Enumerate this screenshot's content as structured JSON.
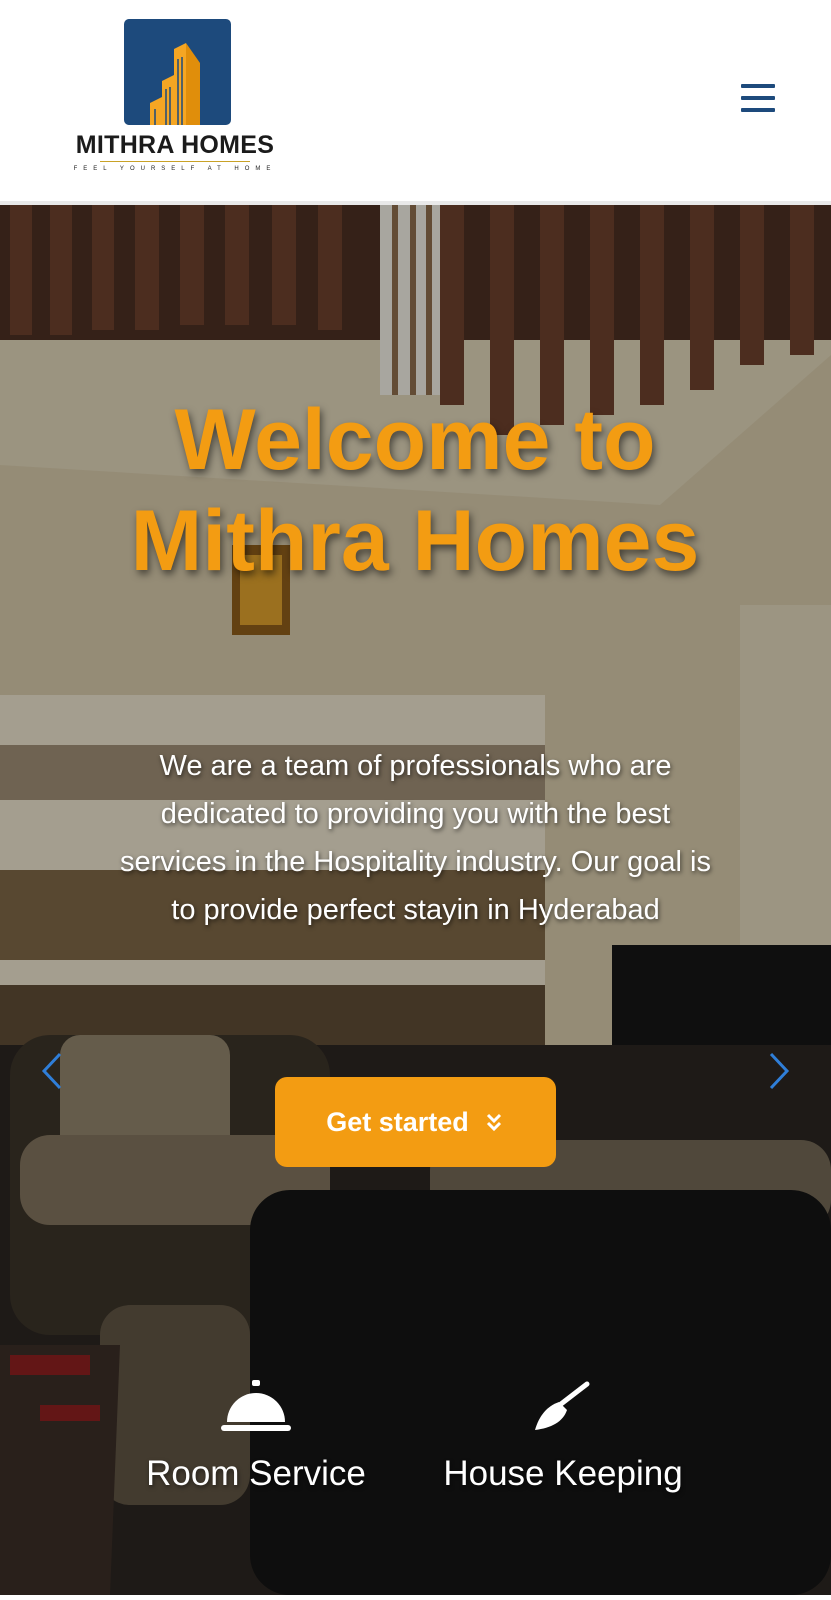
{
  "brand": {
    "name": "MITHRA HOMES",
    "tagline": "FEEL YOURSELF AT HOME",
    "logo_colors": {
      "square": "#1d4a7c",
      "building": "#f5a623"
    }
  },
  "header": {
    "menu_icon": "hamburger-menu-icon"
  },
  "hero": {
    "title": "Welcome to Mithra Homes",
    "description": "We are a team of professionals who are dedicated to providing you with the best services in the Hospitality industry. Our goal is to provide perfect stayin in Hyderabad",
    "cta_label": "Get started",
    "cta_icon": "double-chevron-down-icon",
    "prev_icon": "chevron-left-icon",
    "next_icon": "chevron-right-icon"
  },
  "services": [
    {
      "label": "Room Service",
      "icon": "room-service-bell-icon"
    },
    {
      "label": "House Keeping",
      "icon": "broom-icon"
    }
  ],
  "colors": {
    "accent": "#f39c12",
    "brand_blue": "#1d4a7c",
    "arrow_blue": "#2f7ed8",
    "text_light": "#ffffff"
  }
}
